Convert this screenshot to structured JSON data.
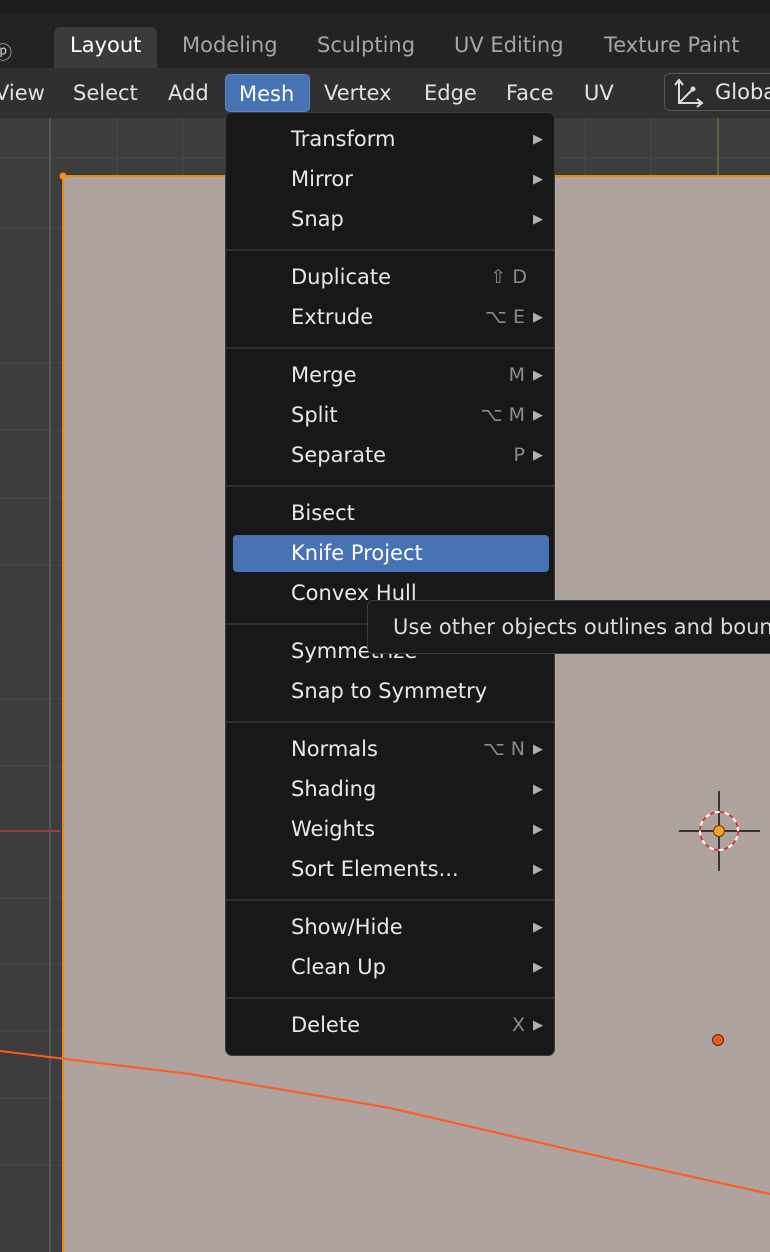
{
  "workspace_tabs": [
    {
      "label": "Layout",
      "active": true
    },
    {
      "label": "Modeling",
      "active": false
    },
    {
      "label": "Sculpting",
      "active": false
    },
    {
      "label": "UV Editing",
      "active": false
    },
    {
      "label": "Texture Paint",
      "active": false
    }
  ],
  "header": {
    "menus": [
      "View",
      "Select",
      "Add",
      "Mesh",
      "Vertex",
      "Edge",
      "Face",
      "UV"
    ],
    "active_menu": "Mesh",
    "orientation_label": "Global",
    "orientation_icon": "transform-orientation-icon"
  },
  "mesh_menu": {
    "items": [
      {
        "label": "Transform",
        "shortcut": "",
        "submenu": true
      },
      {
        "label": "Mirror",
        "shortcut": "",
        "submenu": true
      },
      {
        "label": "Snap",
        "shortcut": "",
        "submenu": true
      },
      {
        "label": "Duplicate",
        "shortcut": "⇧ D",
        "submenu": false
      },
      {
        "label": "Extrude",
        "shortcut": "⌥ E",
        "submenu": true
      },
      {
        "label": "Merge",
        "shortcut": "M",
        "submenu": true
      },
      {
        "label": "Split",
        "shortcut": "⌥ M",
        "submenu": true
      },
      {
        "label": "Separate",
        "shortcut": "P",
        "submenu": true
      },
      {
        "label": "Bisect",
        "shortcut": "",
        "submenu": false
      },
      {
        "label": "Knife Project",
        "shortcut": "",
        "submenu": false,
        "highlighted": true
      },
      {
        "label": "Convex Hull",
        "shortcut": "",
        "submenu": false
      },
      {
        "label": "Symmetrize",
        "shortcut": "",
        "submenu": false
      },
      {
        "label": "Snap to Symmetry",
        "shortcut": "",
        "submenu": false
      },
      {
        "label": "Normals",
        "shortcut": "⌥ N",
        "submenu": true
      },
      {
        "label": "Shading",
        "shortcut": "",
        "submenu": true
      },
      {
        "label": "Weights",
        "shortcut": "",
        "submenu": true
      },
      {
        "label": "Sort Elements...",
        "shortcut": "",
        "submenu": true
      },
      {
        "label": "Show/Hide",
        "shortcut": "",
        "submenu": true
      },
      {
        "label": "Clean Up",
        "shortcut": "",
        "submenu": true
      },
      {
        "label": "Delete",
        "shortcut": "X",
        "submenu": true
      }
    ]
  },
  "tooltip": {
    "text": "Use other objects outlines and boundaries to project knife cuts"
  },
  "colors": {
    "menu_highlight": "#4772b3",
    "mesh_face": "#aea39e",
    "selection_edge": "#ff5a1f",
    "object_outline": "#e58a16"
  }
}
